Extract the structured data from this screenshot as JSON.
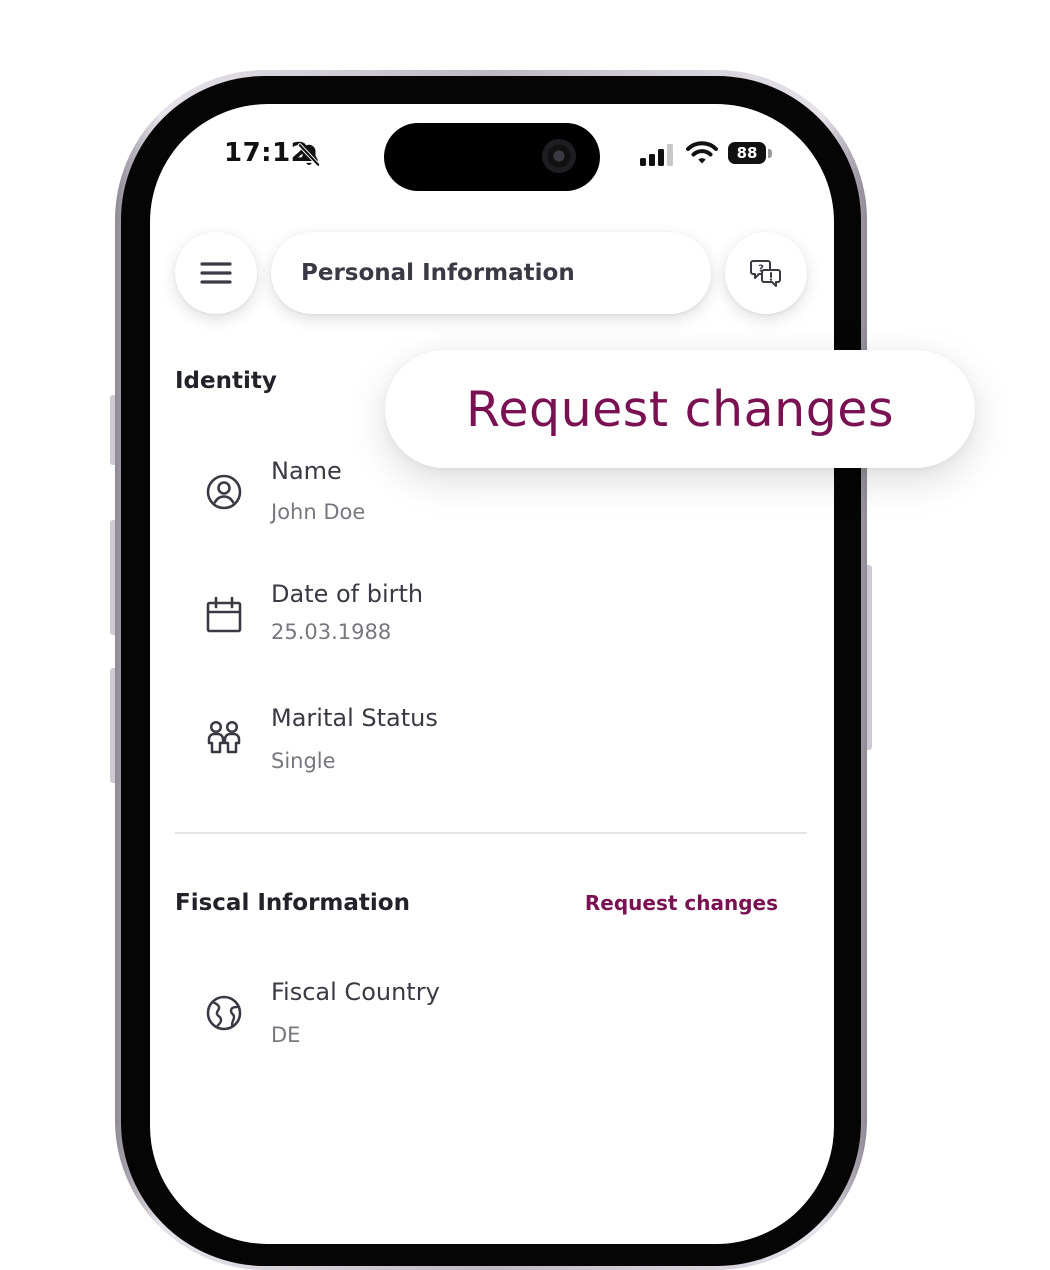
{
  "status_bar": {
    "time": "17:12",
    "battery": "88"
  },
  "app_bar": {
    "title": "Personal Information",
    "menu_icon": "hamburger-menu-icon",
    "support_icon": "chat-question-icon"
  },
  "callout": {
    "text": "Request changes"
  },
  "identity": {
    "title": "Identity",
    "rows": [
      {
        "label": "Name",
        "value": "John Doe",
        "icon": "user-circle-icon"
      },
      {
        "label": "Date of birth",
        "value": "25.03.1988",
        "icon": "calendar-icon"
      },
      {
        "label": "Marital Status",
        "value": "Single",
        "icon": "people-icon"
      }
    ]
  },
  "fiscal": {
    "title": "Fiscal Information",
    "action": "Request changes",
    "rows": [
      {
        "label": "Fiscal Country",
        "value": "DE",
        "icon": "globe-icon"
      }
    ]
  },
  "colors": {
    "accent": "#7a1152",
    "text_primary": "#22222a",
    "text_secondary": "#777780",
    "divider": "#e3e3e8"
  }
}
